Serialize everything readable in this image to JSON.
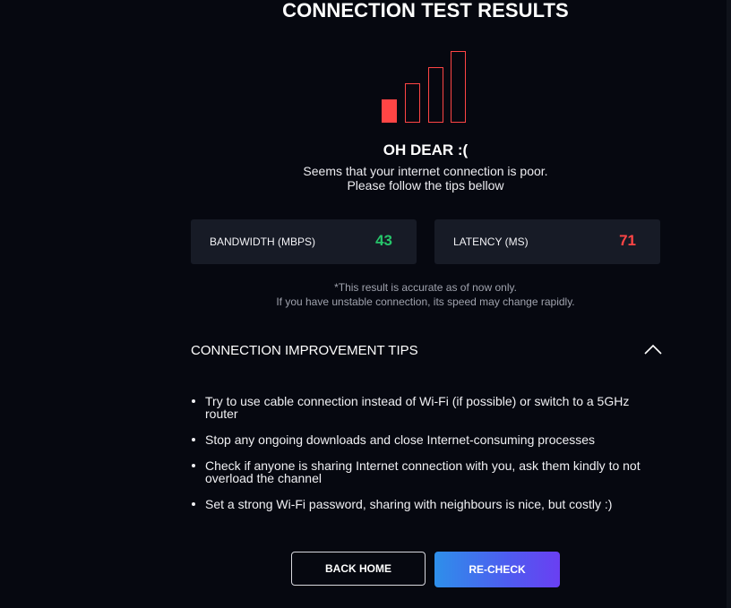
{
  "page": {
    "title": "CONNECTION TEST RESULTS"
  },
  "signal": {
    "level_of_bars": 1,
    "total_bars": 4,
    "color": "#ff4545"
  },
  "status": {
    "heading": "OH DEAR :(",
    "line1": "Seems that your internet connection is poor.",
    "line2": "Please follow the tips bellow"
  },
  "stats": {
    "bandwidth": {
      "label": "BANDWIDTH (MBPS)",
      "value": "43",
      "color": "#26c56a"
    },
    "latency": {
      "label": "LATENCY (MS)",
      "value": "71",
      "color": "#ff4545"
    }
  },
  "note": {
    "line1": "*This result is accurate as of now only.",
    "line2": "If you have unstable connection, its speed may change rapidly."
  },
  "tips": {
    "title": "CONNECTION IMPROVEMENT TIPS",
    "toggle_icon": "chevron-up-icon",
    "items": [
      "Try to use cable connection instead of Wi-Fi (if possible) or switch to a 5GHz router",
      "Stop any ongoing downloads and close Internet-consuming processes",
      "Check if anyone is sharing Internet connection with you, ask them kindly to not overload the channel",
      "Set a strong Wi-Fi password, sharing with neighbours is nice, but costly :)"
    ]
  },
  "actions": {
    "back_label": "BACK HOME",
    "recheck_label": "RE-CHECK"
  }
}
